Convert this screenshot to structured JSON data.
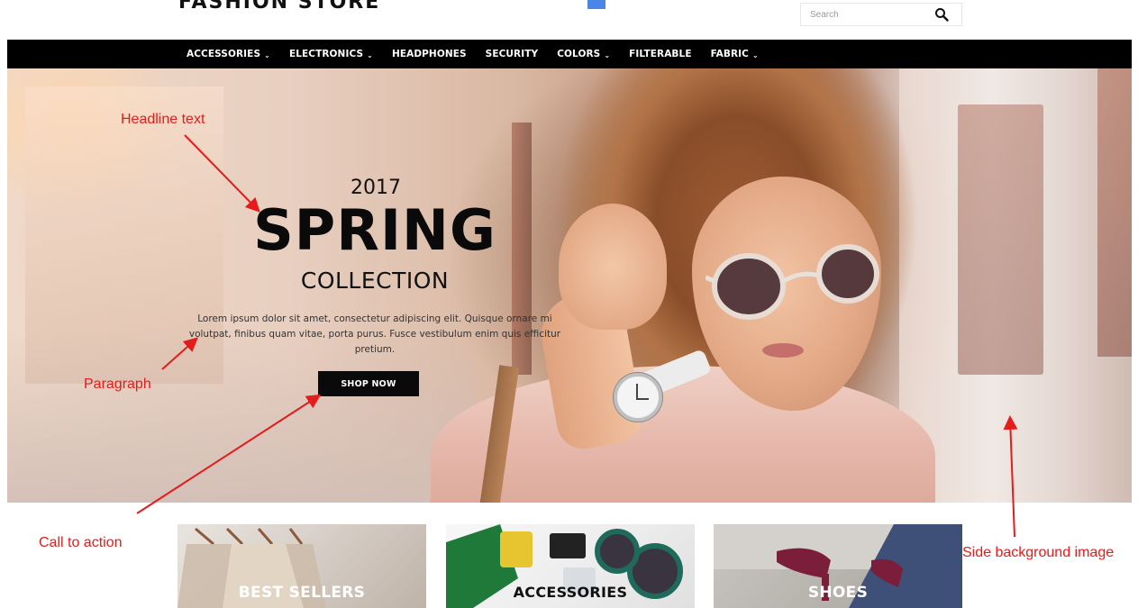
{
  "header": {
    "search": {
      "placeholder": "Search"
    }
  },
  "nav": {
    "items": [
      {
        "label": "ACCESSORIES",
        "has_dropdown": true
      },
      {
        "label": "ELECTRONICS",
        "has_dropdown": true
      },
      {
        "label": "HEADPHONES",
        "has_dropdown": false
      },
      {
        "label": "SECURITY",
        "has_dropdown": false
      },
      {
        "label": "COLORS",
        "has_dropdown": true
      },
      {
        "label": "FILTERABLE",
        "has_dropdown": false
      },
      {
        "label": "FABRIC",
        "has_dropdown": true
      }
    ],
    "chevron_glyph": "⌄"
  },
  "hero": {
    "year": "2017",
    "title": "SPRING",
    "subtitle": "COLLECTION",
    "paragraph": "Lorem ipsum dolor sit amet, consectetur adipiscing elit. Quisque ornare mi volutpat, finibus quam vitae, porta purus. Fusce vestibulum enim quis efficitur pretium.",
    "cta_label": "SHOP NOW"
  },
  "annotations": {
    "headline": "Headline text",
    "paragraph": "Paragraph",
    "cta": "Call to action",
    "side_bg": "Side background image",
    "color": "#e31c1c"
  },
  "tiles": [
    {
      "label": "BEST SELLERS"
    },
    {
      "label": "ACCESSORIES"
    },
    {
      "label": "SHOES"
    }
  ],
  "colors": {
    "nav_bg": "#000000",
    "cta_bg": "#0a0a0a",
    "annotation": "#e31c1c"
  }
}
